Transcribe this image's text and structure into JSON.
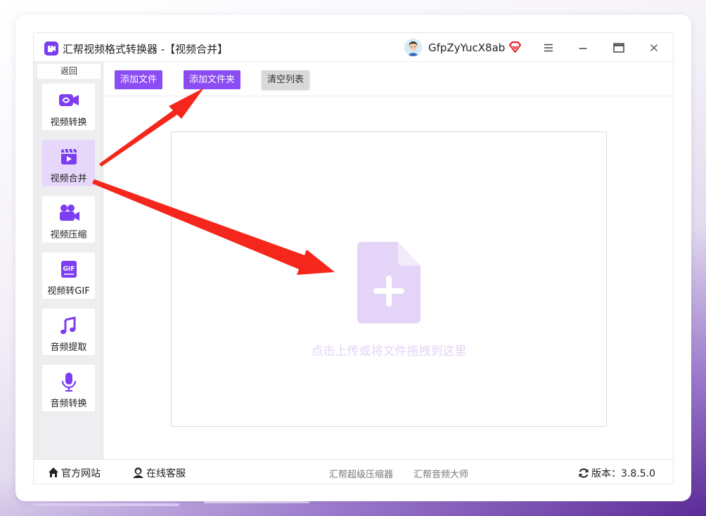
{
  "window": {
    "title": "汇帮视频格式转换器  -【视频合并】",
    "username": "GfpZyYucX8ab"
  },
  "sidebar": {
    "back_label": "返回",
    "items": [
      {
        "label": "视频转换",
        "icon": "video-convert-icon",
        "active": false
      },
      {
        "label": "视频合并",
        "icon": "video-merge-icon",
        "active": true
      },
      {
        "label": "视频压缩",
        "icon": "video-compress-icon",
        "active": false
      },
      {
        "label": "视频转GIF",
        "icon": "gif-icon",
        "active": false
      },
      {
        "label": "音频提取",
        "icon": "music-note-icon",
        "active": false
      },
      {
        "label": "音频转换",
        "icon": "microphone-icon",
        "active": false
      }
    ]
  },
  "toolbar": {
    "add_file": "添加文件",
    "add_folder": "添加文件夹",
    "clear_list": "清空列表"
  },
  "dropzone": {
    "hint": "点击上传或将文件拖拽到这里"
  },
  "footer": {
    "website": "官方网站",
    "support": "在线客服",
    "link1": "汇帮超级压缩器",
    "link2": "汇帮音频大师",
    "version": "版本：3.8.5.0"
  },
  "colors": {
    "accent": "#8b4df3",
    "sidebar_active": "#e7d7fb",
    "drop_icon": "#e4d4f7",
    "annotation_arrow": "#f5261b"
  }
}
